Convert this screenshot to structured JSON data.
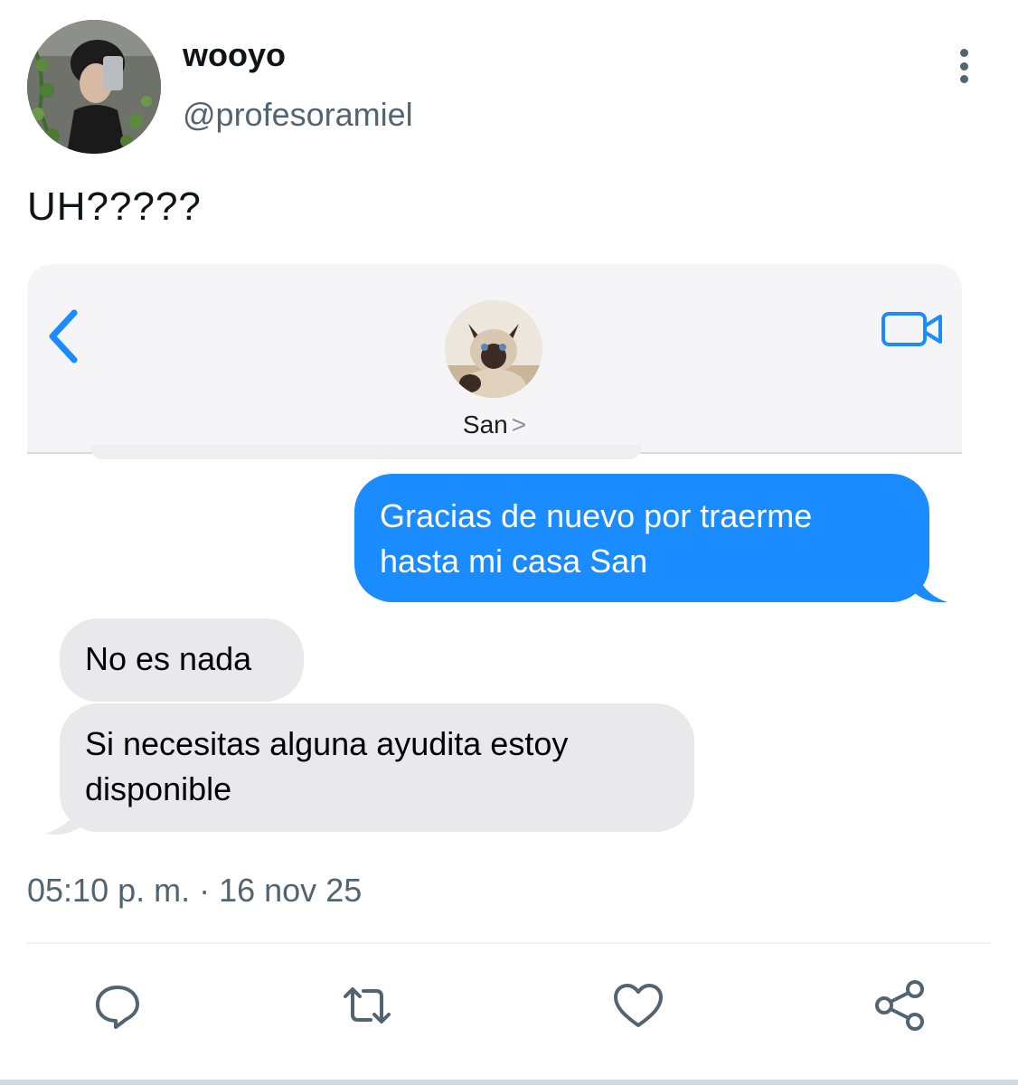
{
  "tweet": {
    "author_name": "wooyo",
    "author_handle": "@profesoramiel",
    "text": "UH?????",
    "timestamp": "05:10 p. m. · 16 nov 25"
  },
  "chat": {
    "contact_name": "San",
    "contact_chevron": ">",
    "accent_color": "#1a8cff",
    "messages": [
      {
        "direction": "outgoing",
        "lines": [
          "Gracias de nuevo por traerme",
          "hasta mi casa San"
        ]
      },
      {
        "direction": "incoming",
        "lines": [
          "No es nada"
        ]
      },
      {
        "direction": "incoming",
        "lines": [
          "Si necesitas alguna ayudita estoy",
          "disponible"
        ]
      }
    ]
  },
  "icons": {
    "more": "more-vertical-icon",
    "back": "chevron-left-icon",
    "video": "video-camera-icon",
    "reply": "reply-icon",
    "retweet": "retweet-icon",
    "like": "heart-icon",
    "share": "share-icon"
  }
}
